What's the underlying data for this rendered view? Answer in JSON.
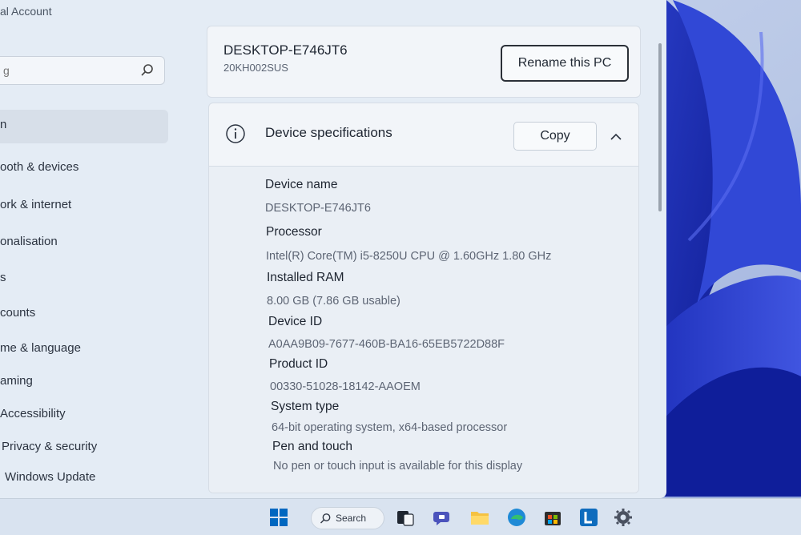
{
  "sidebar": {
    "account_label": "al Account",
    "search_placeholder": "g",
    "items": [
      {
        "label": "n"
      },
      {
        "label": "ooth & devices"
      },
      {
        "label": "ork & internet"
      },
      {
        "label": "onalisation"
      },
      {
        "label": "s"
      },
      {
        "label": "counts"
      },
      {
        "label": "me & language"
      },
      {
        "label": "aming"
      },
      {
        "label": "Accessibility"
      },
      {
        "label": "Privacy & security"
      },
      {
        "label": "Windows Update"
      }
    ]
  },
  "pc": {
    "name": "DESKTOP-E746JT6",
    "model": "20KH002SUS",
    "rename_label": "Rename this PC"
  },
  "device_specs": {
    "title": "Device specifications",
    "copy_label": "Copy",
    "rows": [
      {
        "label": "Device name",
        "value": "DESKTOP-E746JT6"
      },
      {
        "label": "Processor",
        "value": "Intel(R) Core(TM) i5-8250U CPU @ 1.60GHz   1.80 GHz"
      },
      {
        "label": "Installed RAM",
        "value": "8.00 GB (7.86 GB usable)"
      },
      {
        "label": "Device ID",
        "value": "A0AA9B09-7677-460B-BA16-65EB5722D88F"
      },
      {
        "label": "Product ID",
        "value": "00330-51028-18142-AAOEM"
      },
      {
        "label": "System type",
        "value": "64-bit operating system, x64-based processor"
      },
      {
        "label": "Pen and touch",
        "value": "No pen or touch input is available for this display"
      }
    ]
  },
  "taskbar": {
    "search_label": "Search",
    "icons": [
      "windows-start-icon",
      "search-icon",
      "task-view-icon",
      "chat-icon",
      "file-explorer-icon",
      "edge-browser-icon",
      "store-icon",
      "app-l-icon",
      "settings-gear-icon"
    ],
    "accent": "#0067c0"
  }
}
